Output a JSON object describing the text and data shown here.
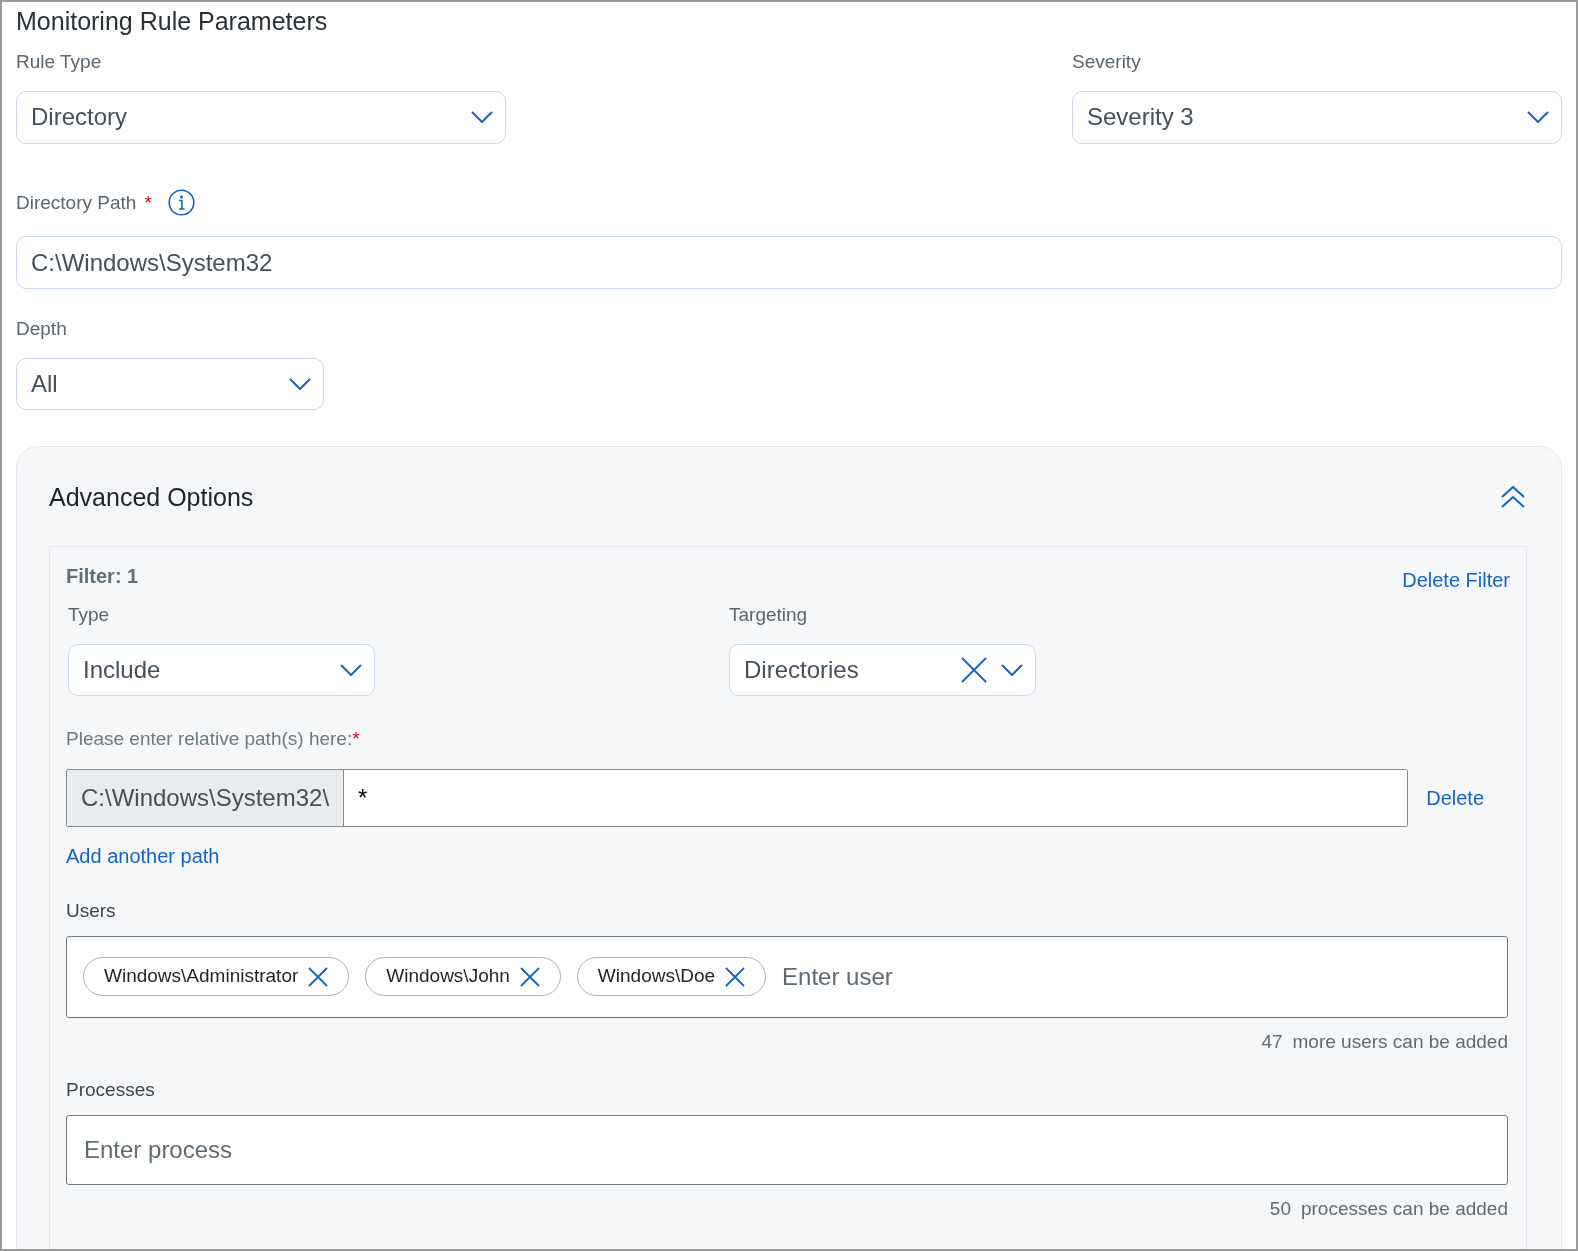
{
  "title": "Monitoring Rule Parameters",
  "rule_type": {
    "label": "Rule Type",
    "value": "Directory"
  },
  "severity": {
    "label": "Severity",
    "value": "Severity 3"
  },
  "directory_path": {
    "label": "Directory Path",
    "required": true,
    "value": "C:\\Windows\\System32"
  },
  "depth": {
    "label": "Depth",
    "value": "All"
  },
  "advanced": {
    "title": "Advanced Options",
    "expanded": true,
    "filters": [
      {
        "title": "Filter: 1",
        "delete_label": "Delete Filter",
        "type": {
          "label": "Type",
          "value": "Include"
        },
        "targeting": {
          "label": "Targeting",
          "value": "Directories"
        },
        "paths_label": "Please enter relative path(s) here:",
        "paths_required": true,
        "paths": [
          {
            "prefix": "C:\\Windows\\System32\\",
            "value": "*",
            "delete_label": "Delete"
          }
        ],
        "add_path": "Add another path",
        "users": {
          "label": "Users",
          "chips": [
            "Windows\\Administrator",
            "Windows\\John",
            "Windows\\Doe"
          ],
          "placeholder": "Enter user",
          "count": "47",
          "note": "more users can be added"
        },
        "processes": {
          "label": "Processes",
          "placeholder": "Enter process",
          "count": "50",
          "note": "processes can be added"
        }
      }
    ]
  }
}
